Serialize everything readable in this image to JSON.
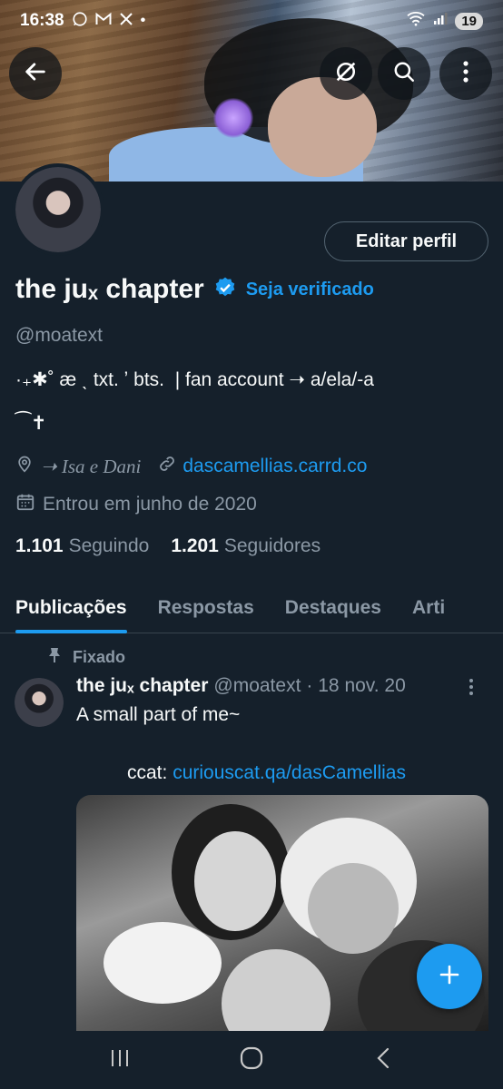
{
  "status_bar": {
    "time": "16:38",
    "notif_icons": [
      "whatsapp-icon",
      "gmail-icon",
      "x-icon"
    ],
    "battery": "19"
  },
  "profile": {
    "edit_label": "Editar perfil",
    "display_name": "the juₓ chapter",
    "verify_label": "Seja verificado",
    "handle": "@moatext",
    "bio_line1": "·₊✱˚ æ ˎ txt. ʼ bts.  | fan account ➝ a/ela/-a",
    "bio_line2": "⁀✝",
    "location": "➝ Isa e Dani",
    "website": "dascamellias.carrd.co",
    "joined": "Entrou em junho de 2020",
    "following_count": "1.101",
    "following_label": "Seguindo",
    "followers_count": "1.201",
    "followers_label": "Seguidores"
  },
  "tabs": [
    {
      "label": "Publicações",
      "active": true
    },
    {
      "label": "Respostas",
      "active": false
    },
    {
      "label": "Destaques",
      "active": false
    },
    {
      "label": "Arti",
      "active": false
    }
  ],
  "pinned_post": {
    "pinned_label": "Fixado",
    "author": "the juₓ chapter",
    "handle": "@moatext",
    "date": "· 18 nov. 20",
    "text": "A small part of me~",
    "ccat_prefix": "ccat: ",
    "ccat_link": "curiouscat.qa/dasCamellias"
  },
  "colors": {
    "accent": "#1d9bf0",
    "background": "#15202b",
    "muted": "#8b98a5"
  }
}
